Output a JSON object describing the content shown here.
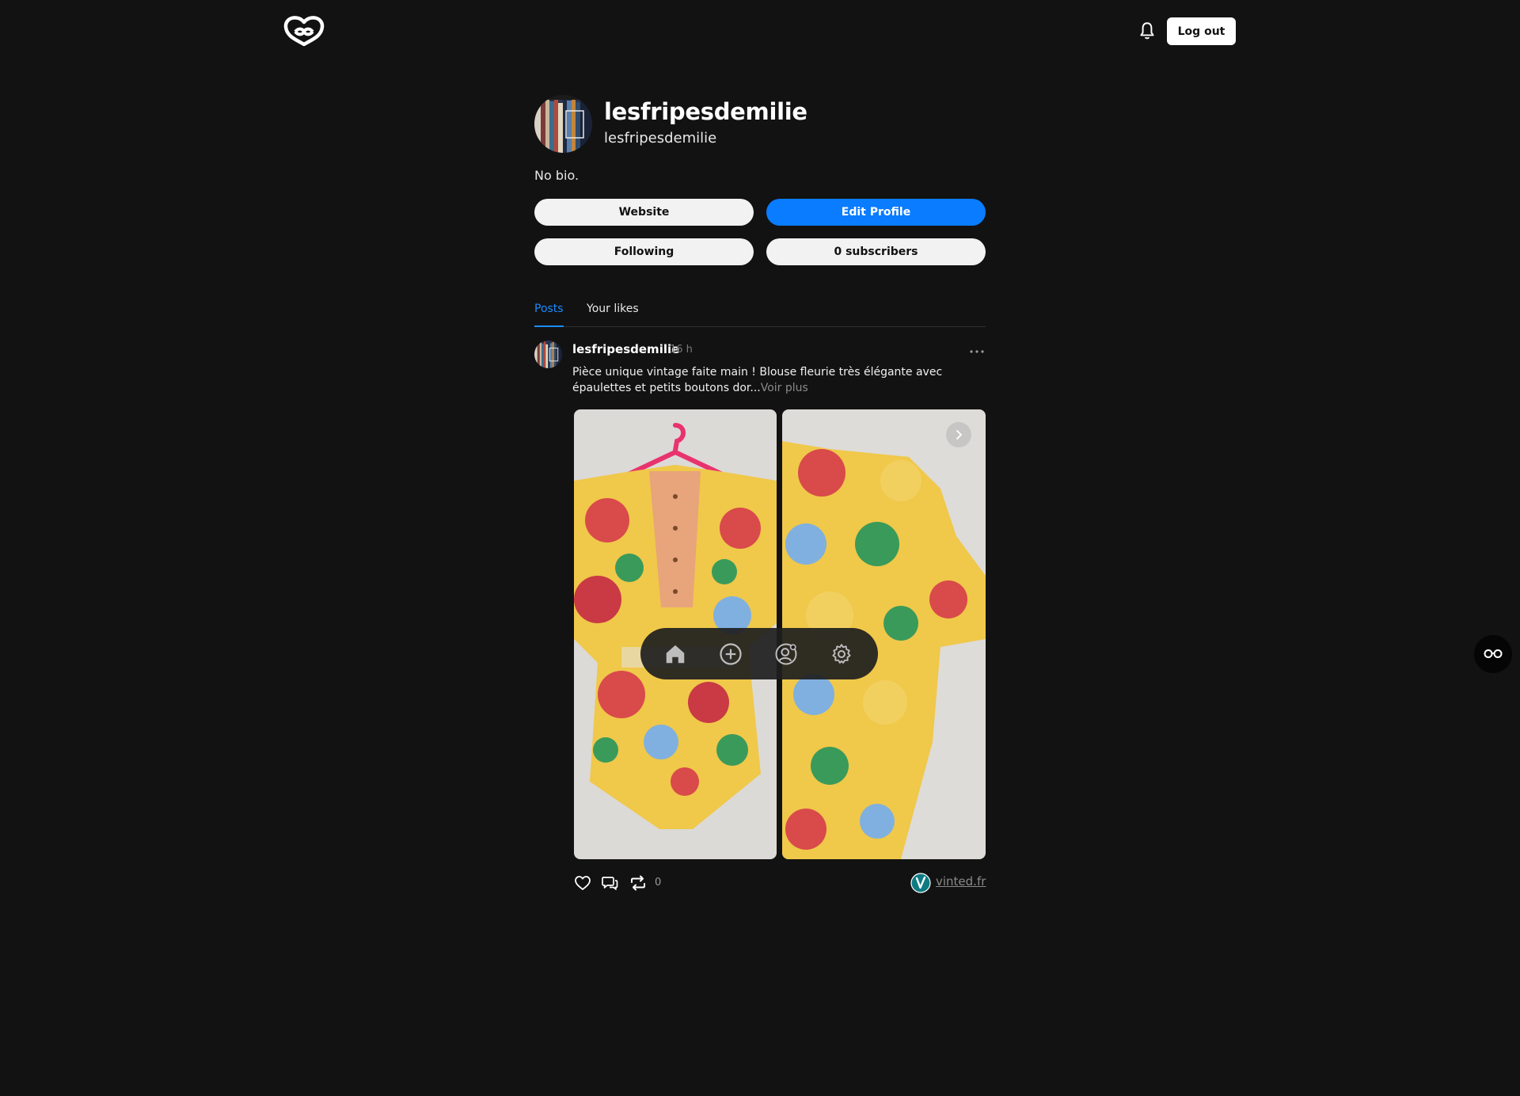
{
  "header": {
    "logout_label": "Log out"
  },
  "profile": {
    "display_name": "lesfripesdemilie",
    "handle": "lesfripesdemilie",
    "bio": "No bio.",
    "buttons": {
      "website": "Website",
      "edit_profile": "Edit Profile",
      "following": "Following",
      "subscribers": "0 subscribers"
    }
  },
  "tabs": [
    {
      "label": "Posts",
      "active": true
    },
    {
      "label": "Your likes",
      "active": false
    }
  ],
  "post": {
    "author": "lesfripesdemilie",
    "time": "16 h",
    "text": "Pièce unique vintage faite main ! Blouse fleurie très élégante avec épaulettes et petits boutons dor...",
    "see_more": "Voir plus",
    "repost_count": "0",
    "source_link": "vinted.fr"
  },
  "colors": {
    "background": "#121212",
    "accent": "#0a7cff",
    "active_tab": "#1a8cff"
  },
  "icons": {
    "logo": "app-logo-icon",
    "notifications": "bell-icon",
    "more": "ellipsis-icon",
    "nav": [
      "home-icon",
      "plus-circle-icon",
      "profile-settings-icon",
      "gear-icon"
    ],
    "actions": [
      "heart-icon",
      "comment-icon",
      "repost-icon"
    ],
    "side": "glasses-icon"
  }
}
